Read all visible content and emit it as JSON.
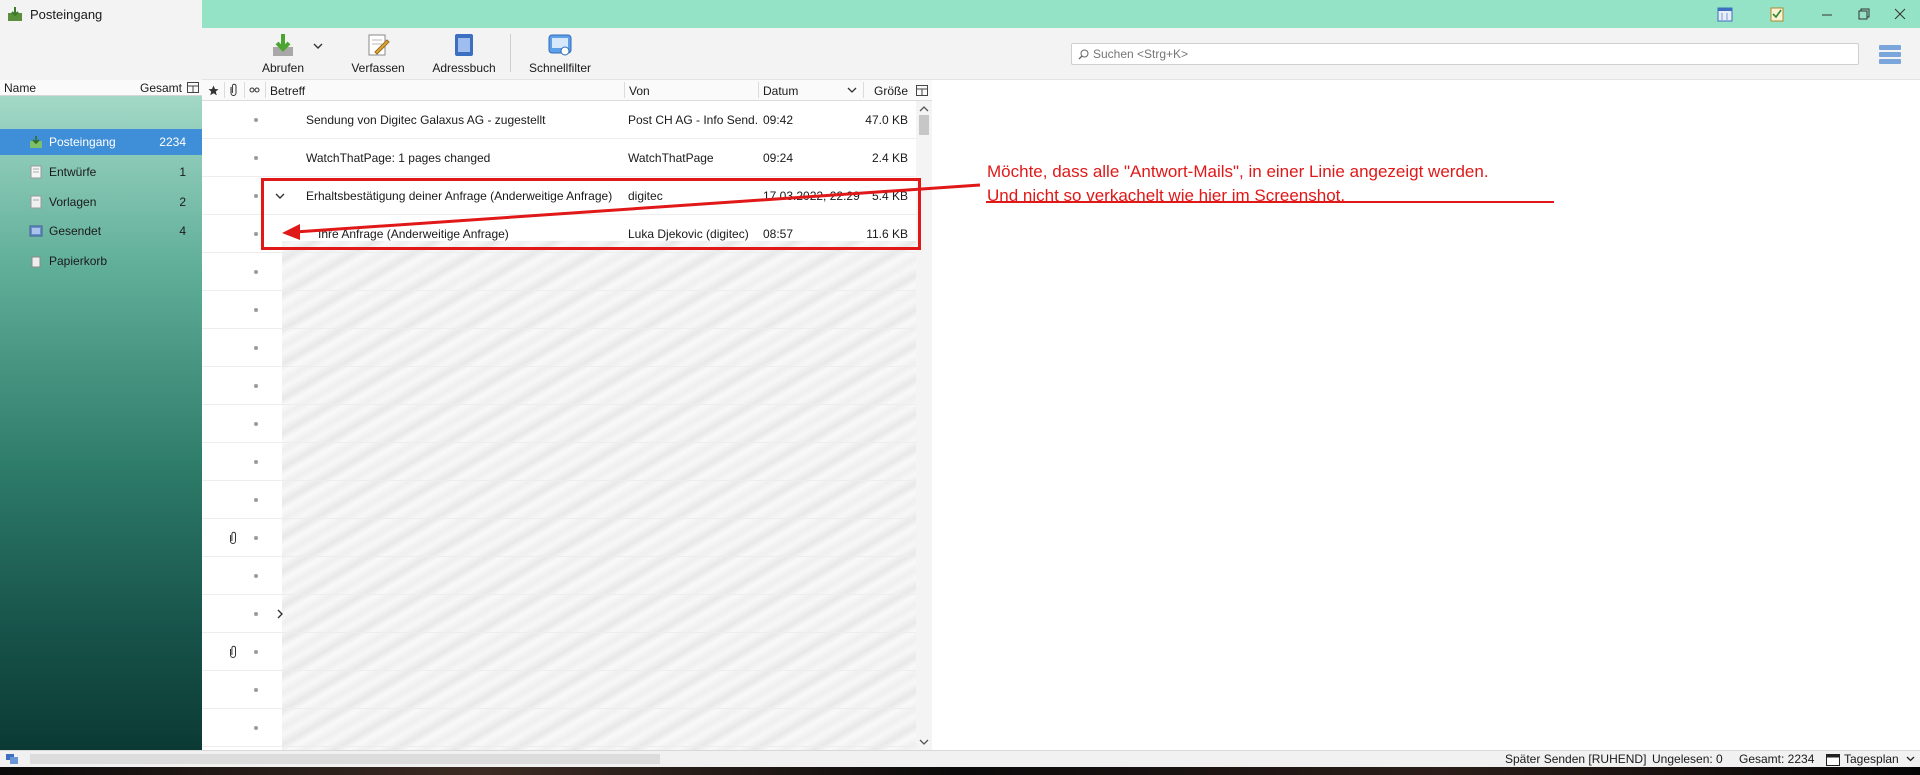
{
  "window": {
    "title": "Posteingang"
  },
  "toolbar": {
    "get_mail": "Abrufen",
    "compose": "Verfassen",
    "address_book": "Adressbuch",
    "quick_filter": "Schnellfilter"
  },
  "search": {
    "placeholder": "Suchen <Strg+K>"
  },
  "folder_pane": {
    "col_name": "Name",
    "col_total": "Gesamt",
    "folders": [
      {
        "label": "Posteingang",
        "count": "2234"
      },
      {
        "label": "Entwürfe",
        "count": "1"
      },
      {
        "label": "Vorlagen",
        "count": "2"
      },
      {
        "label": "Gesendet",
        "count": "4"
      },
      {
        "label": "Papierkorb",
        "count": ""
      }
    ]
  },
  "thread_pane": {
    "columns": {
      "subject": "Betreff",
      "from": "Von",
      "date": "Datum",
      "size": "Größe"
    },
    "messages": [
      {
        "subject": "Sendung von Digitec Galaxus AG - zugestellt",
        "from": "Post CH AG - Info Send...",
        "date": "09:42",
        "size": "47.0 KB"
      },
      {
        "subject": "WatchThatPage: 1 pages changed",
        "from": "WatchThatPage",
        "date": "09:24",
        "size": "2.4 KB"
      },
      {
        "subject": "Erhaltsbestätigung deiner Anfrage (Anderweitige Anfrage)",
        "from": "digitec",
        "date": "17.03.2022, 22:29",
        "size": "5.4 KB"
      },
      {
        "subject": "Ihre Anfrage (Anderweitige Anfrage)",
        "from": "Luka Djekovic (digitec)",
        "date": "08:57",
        "size": "11.6 KB"
      }
    ]
  },
  "annotation": {
    "line1": "Möchte, dass alle \"Antwort-Mails\", in einer Linie angezeigt werden.",
    "line2": "Und nicht so verkachelt wie hier im Screenshot."
  },
  "status": {
    "send_later": "Später Senden [RUHEND]",
    "unread": "Ungelesen: 0",
    "total": "Gesamt: 2234",
    "today_pane": "Tagesplan"
  },
  "colors": {
    "accent": "#3f8fd8",
    "titlebar": "#95e3c6",
    "annotation": "#e01818"
  }
}
